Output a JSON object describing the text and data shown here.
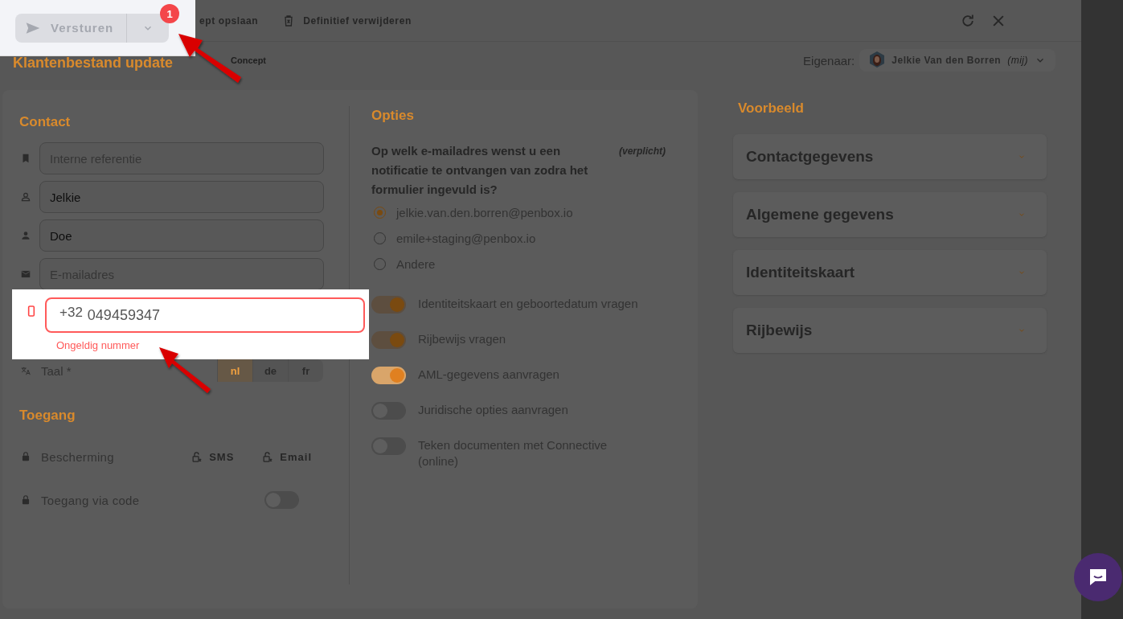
{
  "toolbar": {
    "send_button": "Versturen",
    "badge": "1",
    "save_draft": "ept opslaan",
    "delete": "Definitief verwijderen"
  },
  "title": "Klantenbestand update",
  "status": "Concept",
  "owner": {
    "label": "Eigenaar:",
    "name": "Jelkie Van den Borren",
    "suffix": "(mij)"
  },
  "contact": {
    "heading": "Contact",
    "fields": [
      {
        "placeholder": "Interne referentie"
      },
      {
        "value": "Jelkie"
      },
      {
        "value": "Doe"
      },
      {
        "placeholder": "E-mailadres"
      }
    ],
    "phone": {
      "prefix": "+32",
      "value": "049459347",
      "invalid": true,
      "error": "Ongeldig nummer"
    },
    "language": {
      "label": "Taal *",
      "options": [
        {
          "label": "nl",
          "selected": true
        },
        {
          "label": "de",
          "selected": false
        },
        {
          "label": "fr",
          "selected": false
        }
      ]
    }
  },
  "access": {
    "heading": "Toegang",
    "protection": {
      "label": "Bescherming",
      "options": [
        "SMS",
        "Email"
      ]
    },
    "code": {
      "label": "Toegang via code",
      "on": false
    }
  },
  "options": {
    "heading": "Opties",
    "question": "Op welk e-mailadres wenst u een notificatie te ontvangen van zodra het formulier ingevuld is?",
    "required": "(verplicht)",
    "emails": [
      {
        "label": "jelkie.van.den.borren@penbox.io",
        "selected": true
      },
      {
        "label": "emile+staging@penbox.io",
        "selected": false
      },
      {
        "label": "Andere",
        "selected": false
      }
    ],
    "toggles": [
      {
        "label": "Identiteitskaart en geboortedatum vragen",
        "on": true
      },
      {
        "label": "Rijbewijs vragen",
        "on": true
      },
      {
        "label": "AML-gegevens aanvragen",
        "on": true
      },
      {
        "label": "Juridische opties aanvragen",
        "on": false
      },
      {
        "label": "Teken documenten met Connective (online)",
        "on": false
      }
    ]
  },
  "preview": {
    "heading": "Voorbeeld",
    "sections": [
      "Contactgegevens",
      "Algemene gegevens",
      "Identiteitskaart",
      "Rijbewijs"
    ]
  }
}
